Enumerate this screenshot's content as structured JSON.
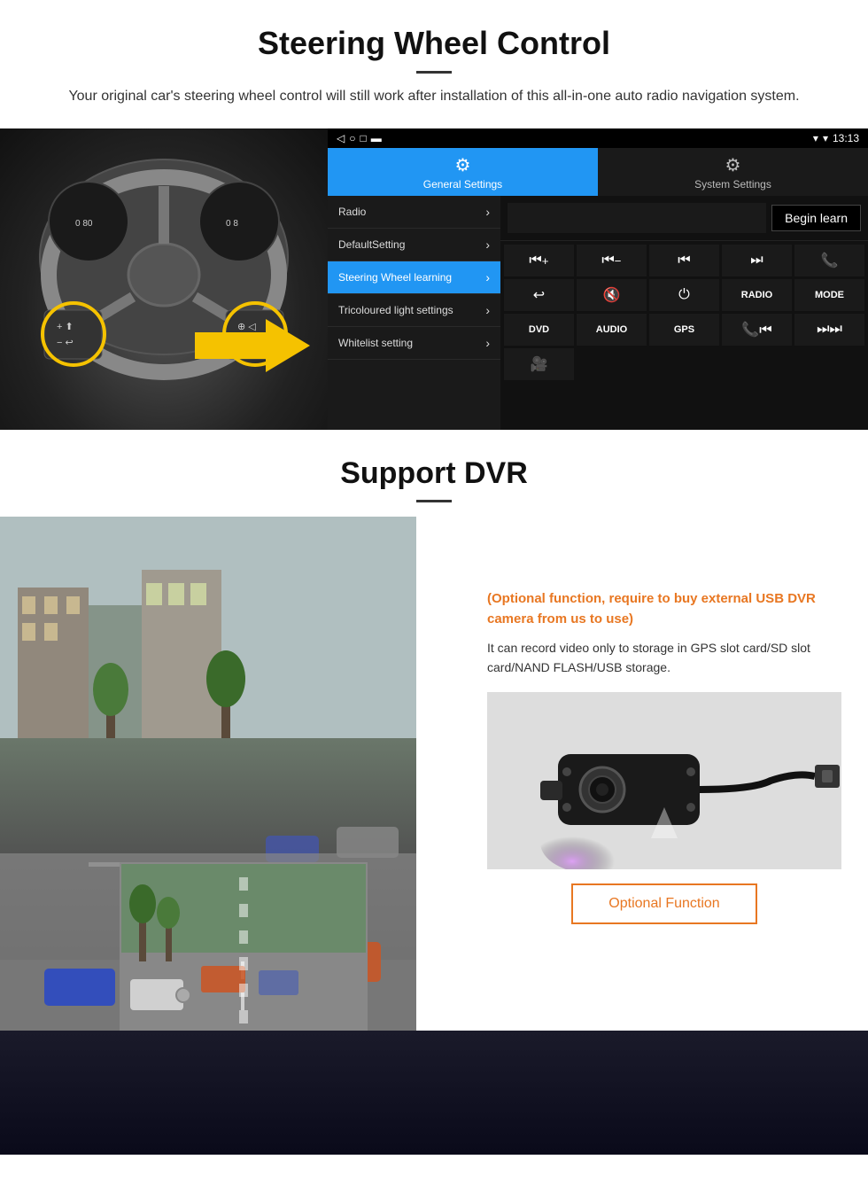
{
  "page": {
    "section1": {
      "title": "Steering Wheel Control",
      "description": "Your original car's steering wheel control will still work after installation of this all-in-one auto radio navigation system."
    },
    "android_ui": {
      "status_bar": {
        "time": "13:13",
        "signal_icon": "▼",
        "wifi_icon": "▾",
        "battery_icon": "▮"
      },
      "tabs": [
        {
          "label": "General Settings",
          "icon": "⚙",
          "active": true
        },
        {
          "label": "System Settings",
          "icon": "⚙",
          "active": false
        }
      ],
      "menu_items": [
        {
          "label": "Radio",
          "active": false
        },
        {
          "label": "DefaultSetting",
          "active": false
        },
        {
          "label": "Steering Wheel learning",
          "active": true
        },
        {
          "label": "Tricoloured light settings",
          "active": false
        },
        {
          "label": "Whitelist setting",
          "active": false
        }
      ],
      "begin_learn_label": "Begin learn",
      "control_buttons": [
        "⏮+",
        "⏮−",
        "⏮",
        "⏭",
        "☎",
        "↩",
        "🔇",
        "⏻",
        "RADIO",
        "MODE",
        "DVD",
        "AUDIO",
        "GPS",
        "📞⏮",
        "⏭⏭"
      ]
    },
    "section2": {
      "title": "Support DVR",
      "optional_heading": "(Optional function, require to buy external USB DVR camera from us to use)",
      "description": "It can record video only to storage in GPS slot card/SD slot card/NAND FLASH/USB storage.",
      "optional_function_label": "Optional Function"
    }
  }
}
